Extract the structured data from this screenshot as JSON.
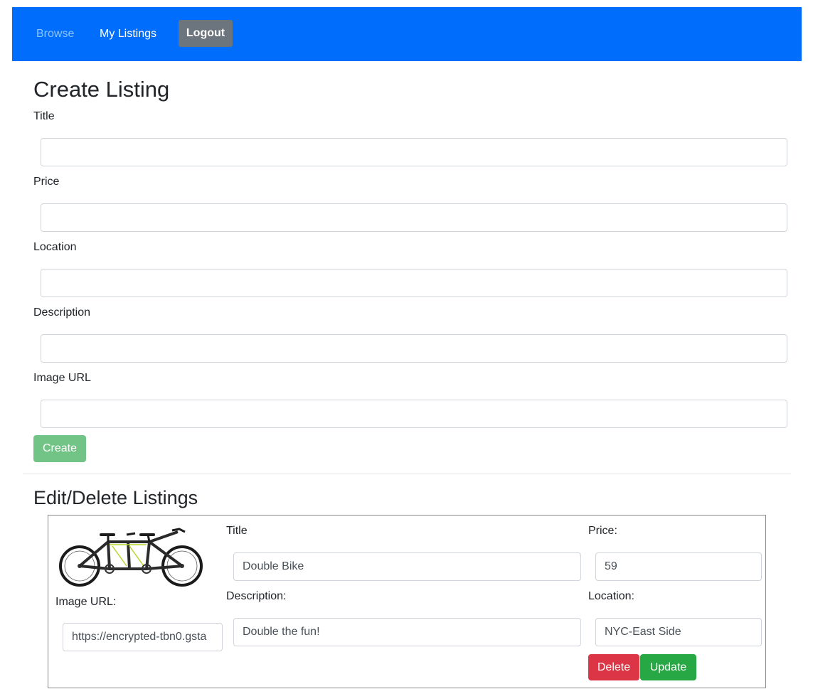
{
  "nav": {
    "browse": "Browse",
    "my_listings": "My Listings",
    "logout": "Logout",
    "bar_color": "#006dfc"
  },
  "create": {
    "heading": "Create Listing",
    "title_label": "Title",
    "title_value": "",
    "price_label": "Price",
    "price_value": "",
    "location_label": "Location",
    "location_value": "",
    "description_label": "Description",
    "description_value": "",
    "image_url_label": "Image URL",
    "image_url_value": "",
    "create_button": "Create"
  },
  "edit": {
    "heading": "Edit/Delete Listings",
    "listings": [
      {
        "image": "tandem-bicycle-image",
        "image_url_label": "Image URL:",
        "image_url_value": "https://encrypted-tbn0.gsta",
        "title_label": "Title",
        "title_value": "Double Bike",
        "description_label": "Description:",
        "description_value": "Double the fun!",
        "price_label": "Price:",
        "price_value": "59",
        "location_label": "Location:",
        "location_value": "NYC-East Side",
        "delete_button": "Delete",
        "update_button": "Update"
      }
    ]
  }
}
